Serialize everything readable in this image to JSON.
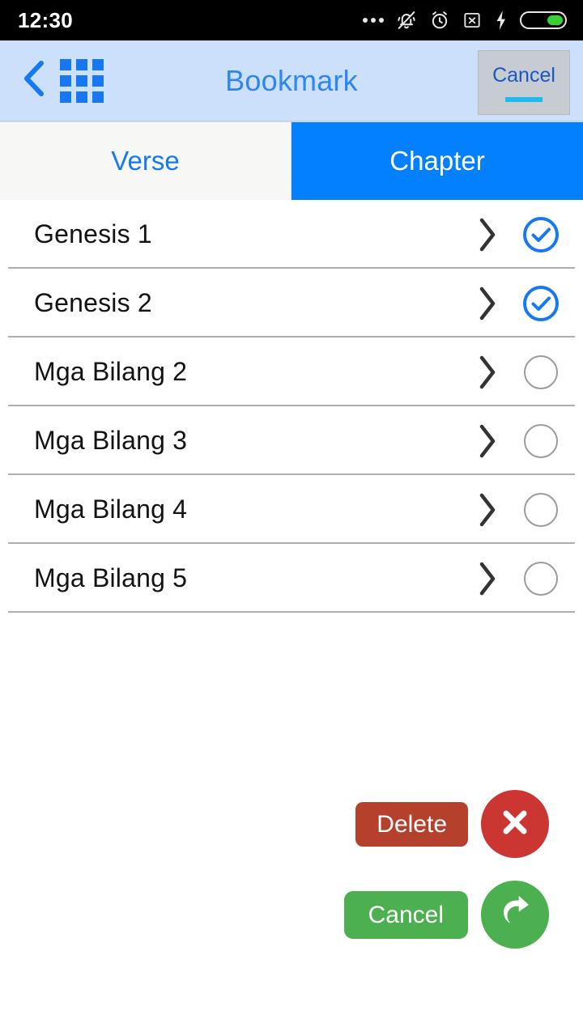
{
  "status_bar": {
    "time": "12:30",
    "icons": [
      {
        "name": "more-dots-icon",
        "glyph": "dots"
      },
      {
        "name": "vibrate-off-icon",
        "glyph": "bell-muted"
      },
      {
        "name": "alarm-clock-icon",
        "glyph": "alarm"
      },
      {
        "name": "sim-x-icon",
        "glyph": "sim-x"
      },
      {
        "name": "charging-bolt-icon",
        "glyph": "bolt"
      },
      {
        "name": "battery-icon",
        "glyph": "battery"
      }
    ],
    "battery_fill_color": "#35d135",
    "background_color": "#000000"
  },
  "navbar": {
    "title": "Bookmark",
    "back_label": "Back",
    "grid_label": "Apps grid",
    "cancel_label": "Cancel",
    "background_color": "#cde0fb",
    "accent_color": "#2d86f5"
  },
  "tabs": [
    {
      "label": "Verse",
      "active": false
    },
    {
      "label": "Chapter",
      "active": true
    }
  ],
  "tab_colors": {
    "active_bg": "#0280ff",
    "active_text": "#ffffff",
    "inactive_bg": "#f7f7f5",
    "inactive_text": "#1778f2"
  },
  "list": {
    "rows": [
      {
        "label": "Genesis 1",
        "checked": true
      },
      {
        "label": "Genesis 2",
        "checked": true
      },
      {
        "label": "Mga Bilang 2",
        "checked": false
      },
      {
        "label": "Mga Bilang 3",
        "checked": false
      },
      {
        "label": "Mga Bilang 4",
        "checked": false
      },
      {
        "label": "Mga Bilang 5",
        "checked": false
      }
    ],
    "checked_color": "#1778f2",
    "unchecked_color": "#9c9c9c"
  },
  "bottom_actions": [
    {
      "label": "Delete",
      "pill_color": "#b5402c",
      "fab_color": "#cc3632",
      "icon": "close-x-icon"
    },
    {
      "label": "Cancel",
      "pill_color": "#4caf50",
      "fab_color": "#4caf50",
      "icon": "redo-arrow-icon"
    }
  ]
}
